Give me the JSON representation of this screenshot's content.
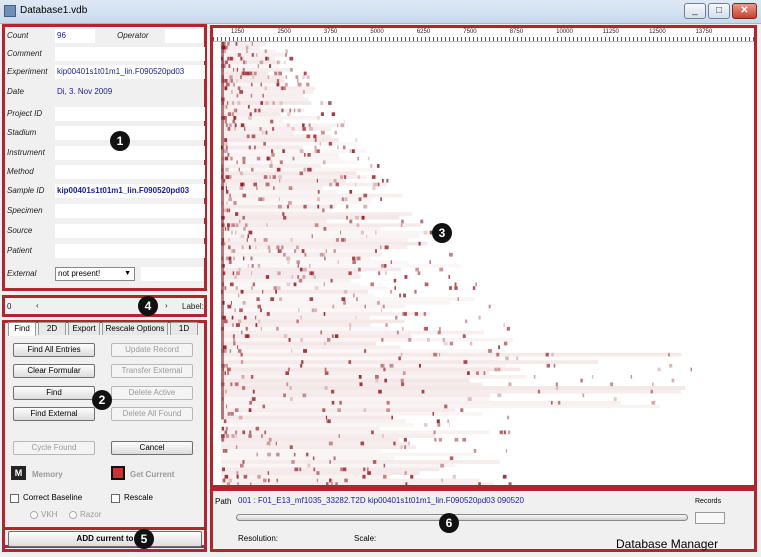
{
  "window": {
    "title": "Database1.vdb",
    "min": "_",
    "max": "□",
    "close": "✕"
  },
  "form": {
    "count_label": "Count",
    "count_value": "96",
    "operator_label": "Operator",
    "operator_value": "",
    "comment_label": "Comment",
    "comment_value": "",
    "experiment_label": "Experiment",
    "experiment_value": "kip00401s1t01m1_lin.F090520pd03",
    "date_label": "Date",
    "date_value": "Di, 3. Nov 2009",
    "project_label": "Project ID",
    "project_value": "",
    "stadium_label": "Stadium",
    "stadium_value": "",
    "instrument_label": "Instrument",
    "instrument_value": "",
    "method_label": "Method",
    "method_value": "",
    "sample_label": "Sample ID",
    "sample_value": "kip00401s1t01m1_lin.F090520pd03",
    "specimen_label": "Specimen",
    "specimen_value": "",
    "source_label": "Source",
    "source_value": "",
    "patient_label": "Patient",
    "patient_value": "",
    "external_label": "External",
    "external_value": "not present!"
  },
  "nav": {
    "index": "0",
    "left": "‹",
    "right": "›",
    "label": "Label:"
  },
  "tabs": [
    "Find",
    "2D",
    "Export",
    "Rescale Options",
    "1D"
  ],
  "buttons": {
    "find_all": "Find All Entries",
    "update_record": "Update Record",
    "clear_formular": "Clear Formular",
    "transfer_external": "Transfer External",
    "find": "Find",
    "delete_active": "Delete Active",
    "find_external": "Find External",
    "delete_all_found": "Delete All Found",
    "cycle_found": "Cycle Found",
    "cancel": "Cancel",
    "memory": "Memory",
    "get_current": "Get Current",
    "correct_baseline": "Correct Baseline",
    "rescale": "Rescale",
    "vkh": "VKH",
    "razor": "Razor",
    "add_current": "ADD current to"
  },
  "ruler_ticks": [
    "1250",
    "2500",
    "3750",
    "5000",
    "6250",
    "7500",
    "8750",
    "10000",
    "11250",
    "12500",
    "13750"
  ],
  "status": {
    "path_label": "Path",
    "path_value": "001 : F01_E13_mf1035_33282.T2D  kip00401s1t01m1_lin.F090520pd03  090520",
    "records_label": "Records",
    "resolution_label": "Resolution:",
    "scale_label": "Scale:",
    "app_name": "Database Manager"
  },
  "markers": [
    "1",
    "2",
    "3",
    "4",
    "5",
    "6"
  ],
  "colors": {
    "annotation": "#b1262e",
    "heat": "#8b0d16",
    "value_text": "#1b1b9a"
  }
}
